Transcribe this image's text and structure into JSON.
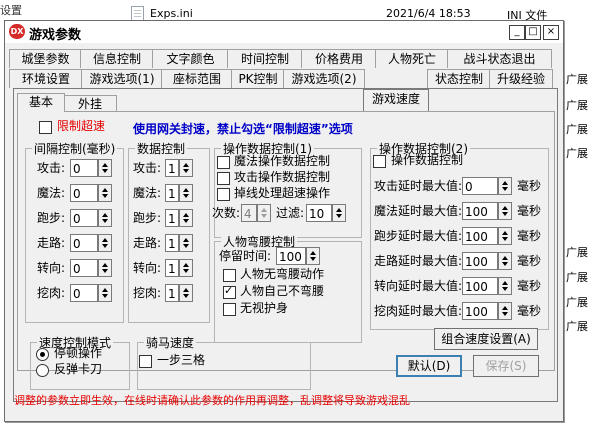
{
  "background": {
    "rows": [
      {
        "name": "Exps.ini",
        "date": "2021/6/4 18:53",
        "type": "INI 文件"
      }
    ],
    "left_fragment": "设置",
    "side_fragments": [
      "广展",
      "广展",
      "广展",
      "广展",
      "广展",
      "广展",
      "广展",
      "广展"
    ]
  },
  "window": {
    "title": "游戏参数",
    "icon_text": "DX",
    "controls": {
      "minimize": "_",
      "maximize": "□",
      "close": "×"
    }
  },
  "tabs": {
    "row1": [
      "城堡参数",
      "信息控制",
      "文字颜色",
      "时间控制",
      "价格费用",
      "人物死亡",
      "战斗状态退出"
    ],
    "row2": [
      "环境设置",
      "游戏选项(1)",
      "座标范围",
      "PK控制",
      "游戏选项(2)",
      "游戏速度",
      "状态控制",
      "升级经验"
    ],
    "active": "游戏速度"
  },
  "subtabs": {
    "items": [
      "基本",
      "外挂"
    ],
    "active": "基本"
  },
  "limit_speed": {
    "label": "限制超速",
    "checked": false
  },
  "notice": "使用网关封速，禁止勾选“限制超速”选项",
  "interval_group": {
    "title": "间隔控制(毫秒)",
    "rows": [
      {
        "label": "攻击:",
        "value": "0"
      },
      {
        "label": "魔法:",
        "value": "0"
      },
      {
        "label": "跑步:",
        "value": "0"
      },
      {
        "label": "走路:",
        "value": "0"
      },
      {
        "label": "转向:",
        "value": "0"
      },
      {
        "label": "挖肉:",
        "value": "0"
      }
    ]
  },
  "count_group": {
    "title": "数据控制",
    "rows": [
      {
        "label": "攻击:",
        "value": "1"
      },
      {
        "label": "魔法:",
        "value": "1"
      },
      {
        "label": "跑步:",
        "value": "1"
      },
      {
        "label": "走路:",
        "value": "1"
      },
      {
        "label": "转向:",
        "value": "1"
      },
      {
        "label": "挖肉:",
        "value": "1"
      }
    ]
  },
  "op1_group": {
    "title": "操作数据控制(1)",
    "checks": [
      {
        "label": "魔法操作数据控制",
        "checked": false
      },
      {
        "label": "攻击操作数据控制",
        "checked": false
      },
      {
        "label": "掉线处理超速操作",
        "checked": false
      }
    ],
    "times_label": "次数:",
    "times_value": "4",
    "filter_label": "过滤:",
    "filter_value": "10"
  },
  "bend_group": {
    "title": "人物弯腰控制",
    "stay_label": "停留时间:",
    "stay_value": "100",
    "checks": [
      {
        "label": "人物无弯腰动作",
        "checked": false
      },
      {
        "label": "人物自己不弯腰",
        "checked": true
      },
      {
        "label": "无视护身",
        "checked": false
      }
    ]
  },
  "op2_group": {
    "title": "操作数据控制(2)",
    "check": {
      "label": "操作数据控制",
      "checked": false
    },
    "rows": [
      {
        "label": "攻击延时最大值:",
        "value": "0",
        "unit": "毫秒"
      },
      {
        "label": "魔法延时最大值:",
        "value": "100",
        "unit": "毫秒"
      },
      {
        "label": "跑步延时最大值:",
        "value": "100",
        "unit": "毫秒"
      },
      {
        "label": "走路延时最大值:",
        "value": "100",
        "unit": "毫秒"
      },
      {
        "label": "转向延时最大值:",
        "value": "100",
        "unit": "毫秒"
      },
      {
        "label": "挖肉延时最大值:",
        "value": "100",
        "unit": "毫秒"
      }
    ]
  },
  "speed_mode_group": {
    "title": "速度控制模式",
    "options": [
      {
        "label": "停顿操作",
        "checked": true
      },
      {
        "label": "反弹卡刀",
        "checked": false
      }
    ]
  },
  "ride_group": {
    "title": "骑马速度",
    "check": {
      "label": "一步三格",
      "checked": false
    }
  },
  "buttons": {
    "combo": "组合速度设置(A)",
    "default": "默认(D)",
    "save": "保存(S)"
  },
  "footer_warning": "调整的参数立即生效，在线时请确认此参数的作用再调整，乱调整将导致游戏混乱"
}
